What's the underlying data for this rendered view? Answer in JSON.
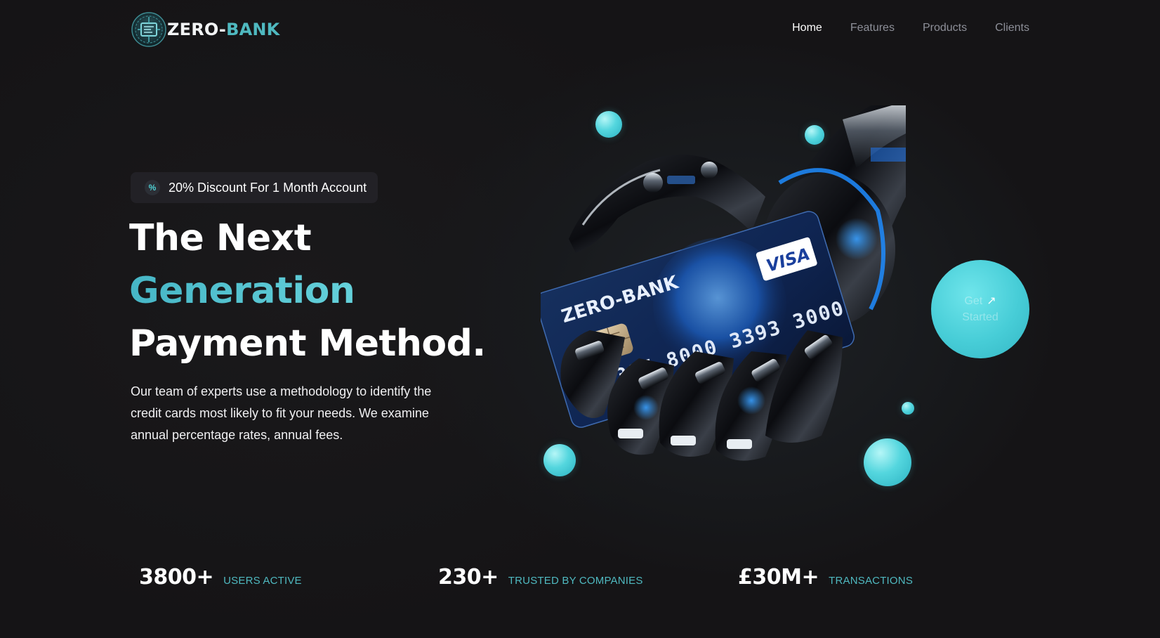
{
  "nav": {
    "logo_white": "ZERO-",
    "logo_accent": "BANK",
    "links": [
      {
        "label": "Home",
        "active": true
      },
      {
        "label": "Features",
        "active": false
      },
      {
        "label": "Products",
        "active": false
      },
      {
        "label": "Clients",
        "active": false
      }
    ]
  },
  "hero": {
    "badge_icon": "percent-icon",
    "badge_text": "20% Discount For 1 Month Account",
    "headline_line1": "The Next",
    "headline_line2": "Generation",
    "headline_line3": "Payment Method.",
    "description": "Our team of experts use a methodology to identify the credit cards most likely to fit your needs. We examine annual percentage rates, annual fees.",
    "cta_line1": "Get",
    "cta_line2": "Started",
    "card_brand": "ZERO-BANK",
    "card_number": "3397 8000 3393 3000",
    "card_network": "VISA",
    "accent_color": "#4fb9c0"
  },
  "stats": [
    {
      "value": "3800+",
      "label": "USERS ACTIVE"
    },
    {
      "value": "230+",
      "label": "TRUSTED BY COMPANIES"
    },
    {
      "value": "£30M+",
      "label": "TRANSACTIONS"
    }
  ]
}
